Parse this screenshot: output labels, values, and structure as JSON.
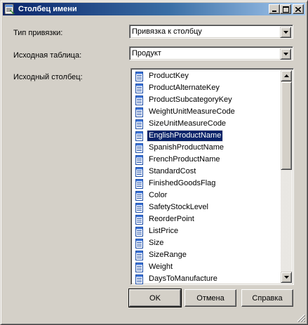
{
  "window": {
    "title": "Столбец имени"
  },
  "form": {
    "binding_type": {
      "label": "Тип привязки:",
      "value": "Привязка к столбцу"
    },
    "source_table": {
      "label": "Исходная таблица:",
      "value": "Продукт"
    },
    "source_column": {
      "label": "Исходный столбец:",
      "items": [
        "ProductKey",
        "ProductAlternateKey",
        "ProductSubcategoryKey",
        "WeightUnitMeasureCode",
        "SizeUnitMeasureCode",
        "EnglishProductName",
        "SpanishProductName",
        "FrenchProductName",
        "StandardCost",
        "FinishedGoodsFlag",
        "Color",
        "SafetyStockLevel",
        "ReorderPoint",
        "ListPrice",
        "Size",
        "SizeRange",
        "Weight",
        "DaysToManufacture"
      ],
      "selected": "EnglishProductName"
    }
  },
  "buttons": {
    "ok": "OK",
    "cancel": "Отмена",
    "help": "Справка"
  },
  "colors": {
    "title_active": "#0a246a",
    "title_gradient_end": "#a6caf0",
    "selection": "#0a246a",
    "face": "#d4d0c8"
  },
  "icons": {
    "title": "column-properties-icon",
    "item": "table-column-icon"
  }
}
